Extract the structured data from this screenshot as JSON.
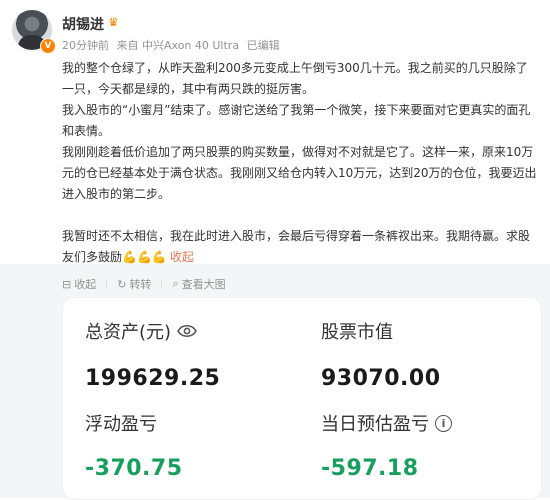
{
  "author": {
    "name": "胡锡进",
    "badge_icon": "crown-icon",
    "verified_color": "#ff8200"
  },
  "meta": {
    "time": "20分钟前",
    "source": "来自 中兴Axon 40 Ultra",
    "edited": "已编辑"
  },
  "post": {
    "p1": "我的整个仓绿了，从昨天盈利200多元变成上午倒亏300几十元。我之前买的几只股除了一只，今天都是绿的，其中有两只跌的挺厉害。",
    "p2": "我入股市的“小蜜月”结束了。感谢它送给了我第一个微笑，接下来要面对它更真实的面孔和表情。",
    "p3": "我刚刚趁着低价追加了两只股票的购买数量，做得对不对就是它了。这样一来，原来10万元的仓已经基本处于满仓状态。我刚刚又给仓内转入10万元，达到20万的仓位，我要迈出进入股市的第二步。",
    "p4": "我暂时还不太相信，我在此时进入股市，会最后亏得穿着一条裤衩出来。我期待赢。求股友们多鼓励",
    "emojis": "💪💪💪",
    "collapse_label": "收起"
  },
  "actions": {
    "collapse": "收起",
    "repost": "转转",
    "view_large": "查看大图"
  },
  "screenshot": {
    "total_assets_label": "总资产(元)",
    "total_assets_value": "199629.25",
    "market_value_label": "股票市值",
    "market_value_value": "93070.00",
    "floating_pl_label": "浮动盈亏",
    "floating_pl_value": "-370.75",
    "daily_pl_label": "当日预估盈亏",
    "daily_pl_value": "-597.18",
    "loss_color": "#17a05d"
  }
}
